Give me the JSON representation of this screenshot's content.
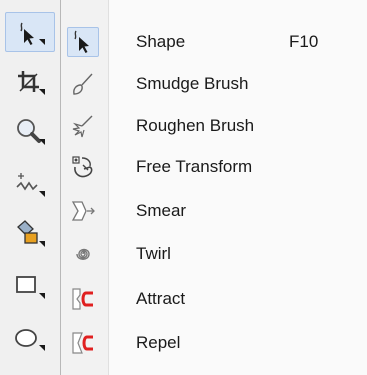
{
  "toolbox": {
    "tools": [
      {
        "name": "shape-tool-group",
        "icon": "shape-arrow-icon",
        "active": true
      },
      {
        "name": "crop-tool-group",
        "icon": "crop-icon"
      },
      {
        "name": "zoom-tool-group",
        "icon": "zoom-icon"
      },
      {
        "name": "freehand-tool-group",
        "icon": "freehand-icon"
      },
      {
        "name": "smart-fill-tool-group",
        "icon": "smart-fill-icon"
      },
      {
        "name": "rectangle-tool-group",
        "icon": "rectangle-icon"
      },
      {
        "name": "ellipse-tool-group",
        "icon": "ellipse-icon"
      }
    ]
  },
  "flyout": {
    "items": [
      {
        "label": "Shape",
        "shortcut": "F10",
        "icon": "shape-arrow-icon",
        "selected": true
      },
      {
        "label": "Smudge Brush",
        "icon": "smudge-brush-icon"
      },
      {
        "label": "Roughen Brush",
        "icon": "roughen-brush-icon"
      },
      {
        "label": "Free Transform",
        "icon": "free-transform-icon"
      },
      {
        "label": "Smear",
        "icon": "smear-icon"
      },
      {
        "label": "Twirl",
        "icon": "twirl-icon"
      },
      {
        "label": "Attract",
        "icon": "attract-icon"
      },
      {
        "label": "Repel",
        "icon": "repel-icon"
      }
    ]
  },
  "colors": {
    "highlight": "#d9e6f6",
    "highlight_border": "#a8c3e8",
    "magnet_red": "#e02020",
    "icon_gray": "#6a6a6a",
    "icon_dark": "#1a1a1a"
  }
}
